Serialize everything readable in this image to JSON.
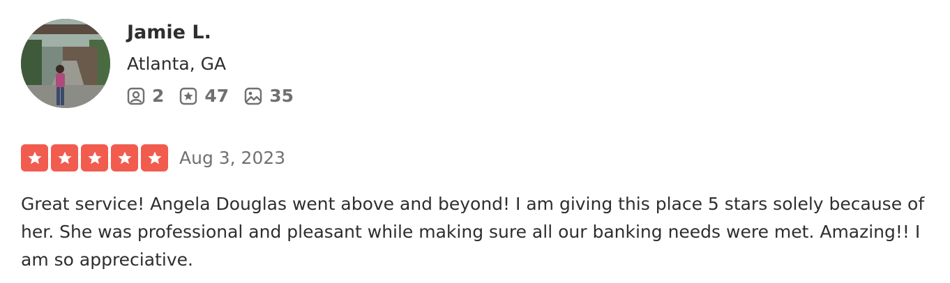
{
  "reviewer": {
    "name": "Jamie L.",
    "location": "Atlanta, GA",
    "stats": {
      "friends": "2",
      "reviews": "47",
      "photos": "35"
    }
  },
  "review": {
    "rating": 5,
    "rating_max": 5,
    "date": "Aug 3, 2023",
    "text": "Great service! Angela Douglas went above and beyond! I am giving this place 5 stars solely because of her. She was professional and pleasant while making sure all our banking needs were met. Amazing!! I am so appreciative."
  },
  "colors": {
    "star_fill": "#f15c4f",
    "text_primary": "#2d2e2f",
    "text_secondary": "#6e7072"
  },
  "icons": {
    "friends": "friends-icon",
    "reviews": "review-star-icon",
    "photos": "photo-icon"
  }
}
